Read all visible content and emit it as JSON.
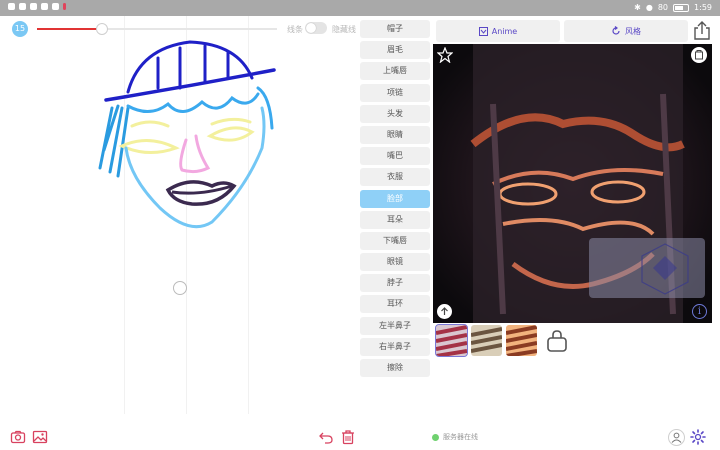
{
  "status_bar": {
    "time": "",
    "battery": "80",
    "extra": "1:59"
  },
  "brush": {
    "size": "15",
    "slider_value": 0.27
  },
  "canvas_header": {
    "line_label": "线条",
    "hide_label": "隐藏线"
  },
  "parts": [
    {
      "label": "帽子",
      "active": false
    },
    {
      "label": "眉毛",
      "active": false
    },
    {
      "label": "上嘴唇",
      "active": false
    },
    {
      "label": "项链",
      "active": false
    },
    {
      "label": "头发",
      "active": false
    },
    {
      "label": "眼睛",
      "active": false
    },
    {
      "label": "嘴巴",
      "active": false
    },
    {
      "label": "衣服",
      "active": false
    },
    {
      "label": "脸部",
      "active": true
    },
    {
      "label": "耳朵",
      "active": false
    },
    {
      "label": "下嘴唇",
      "active": false
    },
    {
      "label": "眼镜",
      "active": false
    },
    {
      "label": "脖子",
      "active": false
    },
    {
      "label": "耳环",
      "active": false
    },
    {
      "label": "左半鼻子",
      "active": false
    },
    {
      "label": "右半鼻子",
      "active": false
    },
    {
      "label": "擦除",
      "active": false
    }
  ],
  "toolbar": {
    "anime_label": "Anime",
    "style_label": "风格"
  },
  "bottom": {
    "server_status": "服务器在线"
  },
  "colors": {
    "accent": "#5a48c6",
    "active_part": "#8fd0f7",
    "slider": "#e13434",
    "online": "#6fd16f"
  }
}
